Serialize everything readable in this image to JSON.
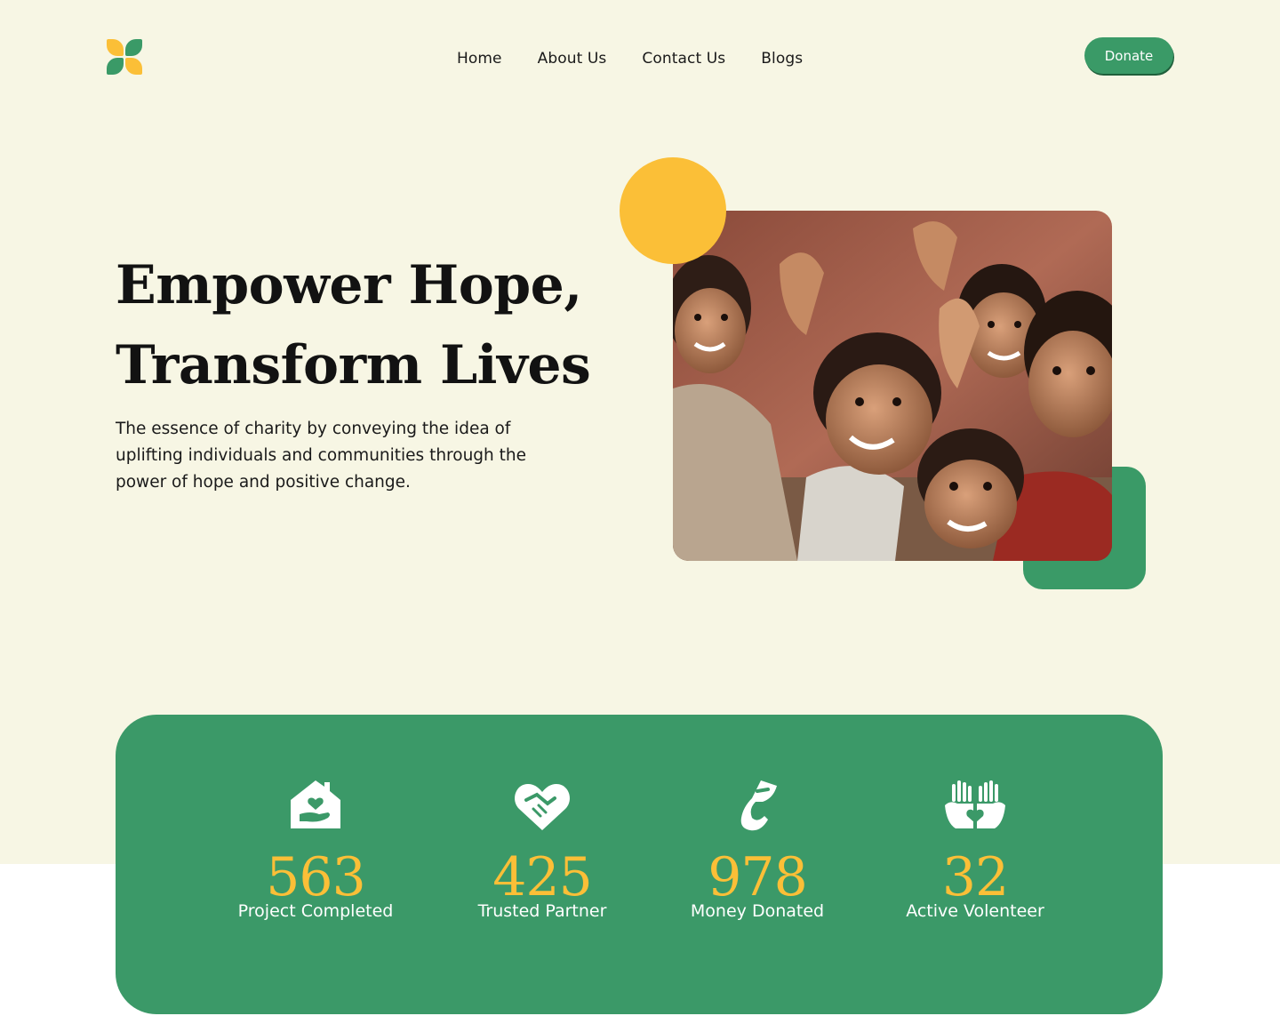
{
  "brand": {
    "logo_icon": "four-petal-logo-icon",
    "colors": {
      "green": "#3a9a67",
      "yellow": "#fbbf37",
      "cream": "#f7f6e4"
    }
  },
  "nav": {
    "items": [
      {
        "label": "Home"
      },
      {
        "label": "About Us"
      },
      {
        "label": "Contact Us"
      },
      {
        "label": "Blogs"
      }
    ]
  },
  "header": {
    "donate_label": "Donate"
  },
  "hero": {
    "headline_line1": "Empower Hope,",
    "headline_line2": "Transform Lives",
    "subtext": "The essence of charity by conveying the idea of uplifting individuals and communities through the power of hope and positive change.",
    "image": "smiling-children-photo"
  },
  "stats": [
    {
      "icon": "house-heart-icon",
      "value": "563",
      "label": "Project Completed"
    },
    {
      "icon": "handshake-heart-icon",
      "value": "425",
      "label": "Trusted Partner"
    },
    {
      "icon": "hand-coin-icon",
      "value": "978",
      "label": "Money Donated"
    },
    {
      "icon": "raised-hands-heart-icon",
      "value": "32",
      "label": "Active Volenteer"
    }
  ]
}
